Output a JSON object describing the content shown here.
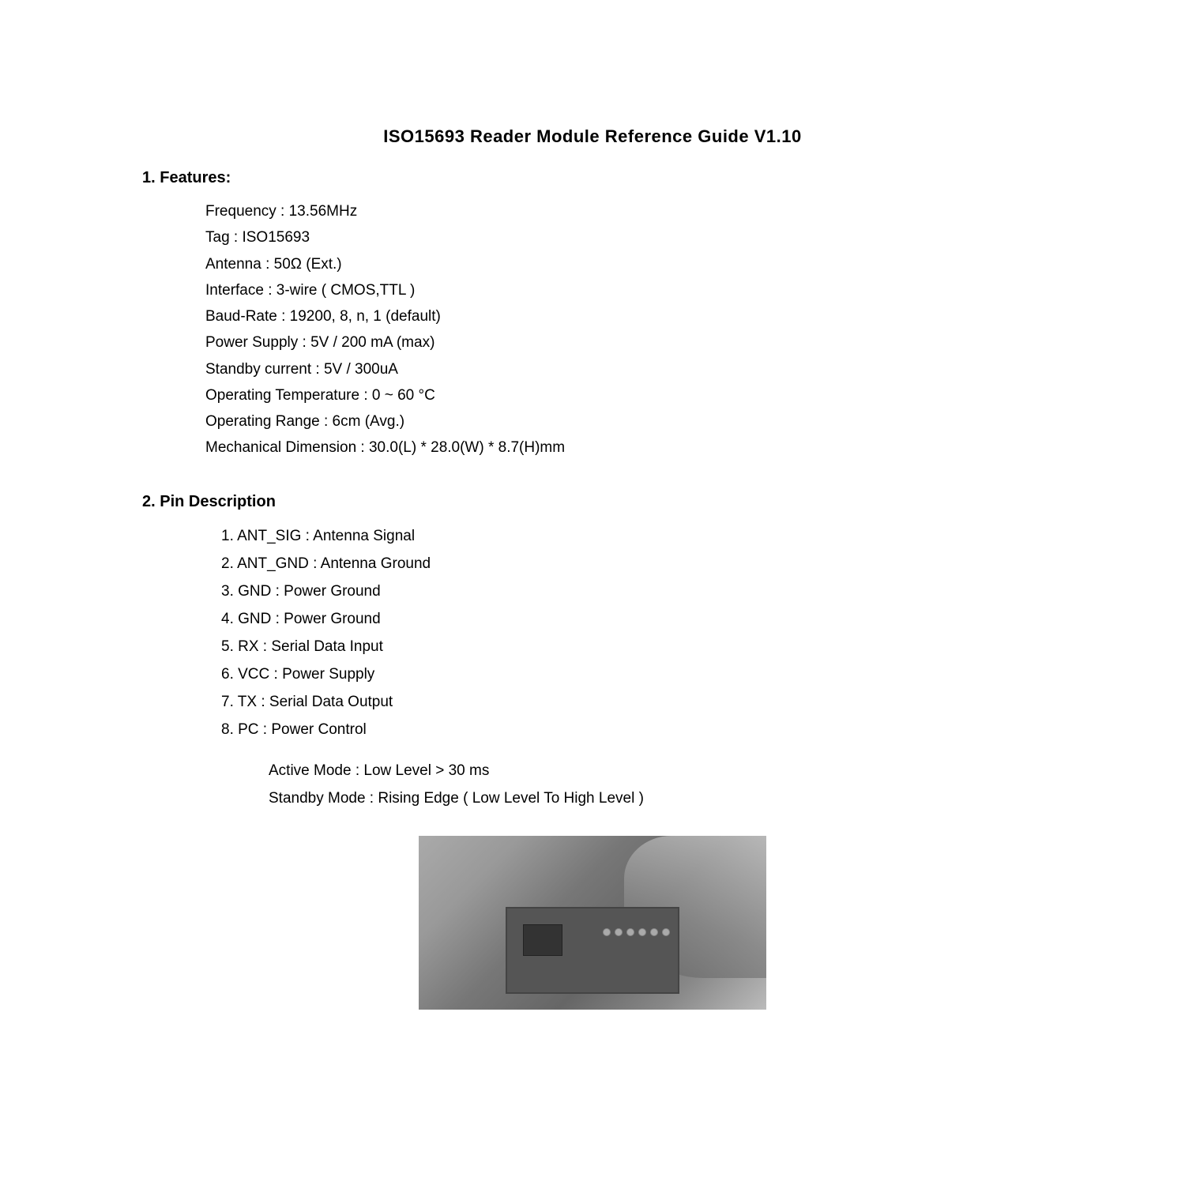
{
  "page": {
    "title": "ISO15693 Reader Module Reference Guide V1.10"
  },
  "section1": {
    "heading": "1. Features:",
    "items": [
      "Frequency : 13.56MHz",
      "Tag : ISO15693",
      "Antenna : 50Ω (Ext.)",
      "Interface : 3-wire ( CMOS,TTL )",
      "Baud-Rate : 19200, 8, n, 1 (default)",
      "Power Supply : 5V / 200 mA (max)",
      "Standby current : 5V / 300uA",
      "Operating Temperature :    0 ~ 60 °C",
      "Operating Range :    6cm (Avg.)",
      "Mechanical Dimension : 30.0(L) * 28.0(W) * 8.7(H)mm"
    ]
  },
  "section2": {
    "heading": "2. Pin Description",
    "pins": [
      "1. ANT_SIG : Antenna Signal",
      "2. ANT_GND : Antenna Ground",
      "3. GND : Power Ground",
      "4. GND : Power Ground",
      "5. RX : Serial Data Input",
      "6. VCC : Power Supply",
      "7. TX : Serial Data Output",
      "8. PC : Power Control"
    ],
    "pc_modes": [
      "Active Mode : Low Level > 30 ms",
      "Standby Mode : Rising Edge ( Low Level To High Level )"
    ]
  }
}
